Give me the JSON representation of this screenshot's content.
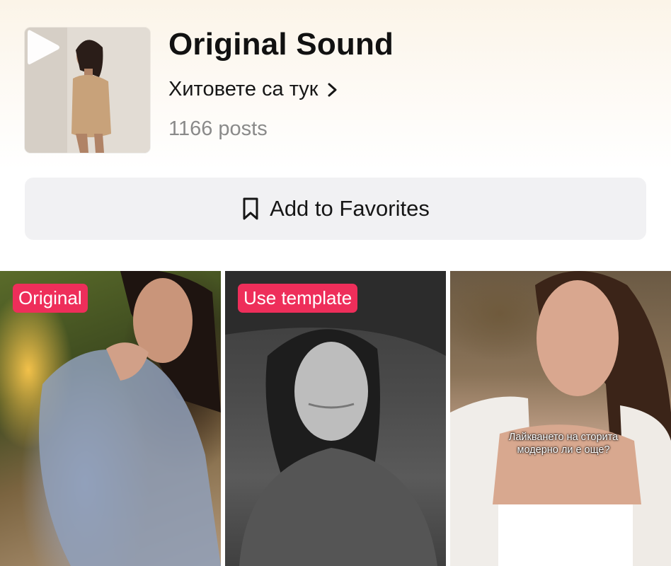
{
  "sound": {
    "title": "Original Sound",
    "artist": "Хитовете са тук",
    "post_count": "1166 posts",
    "cover_icon": "play-icon",
    "artist_chevron_icon": "chevron-right-icon"
  },
  "favorites": {
    "label": "Add to Favorites",
    "icon": "bookmark-icon"
  },
  "videos": [
    {
      "badge": "Original",
      "caption": ""
    },
    {
      "badge": "Use template",
      "caption": ""
    },
    {
      "badge": "",
      "caption": "Лайкването на сторита модерно ли е още?"
    }
  ],
  "colors": {
    "badge": "#ee2e5a",
    "button_bg": "#f1f1f3",
    "muted_text": "#8a8a8a"
  }
}
